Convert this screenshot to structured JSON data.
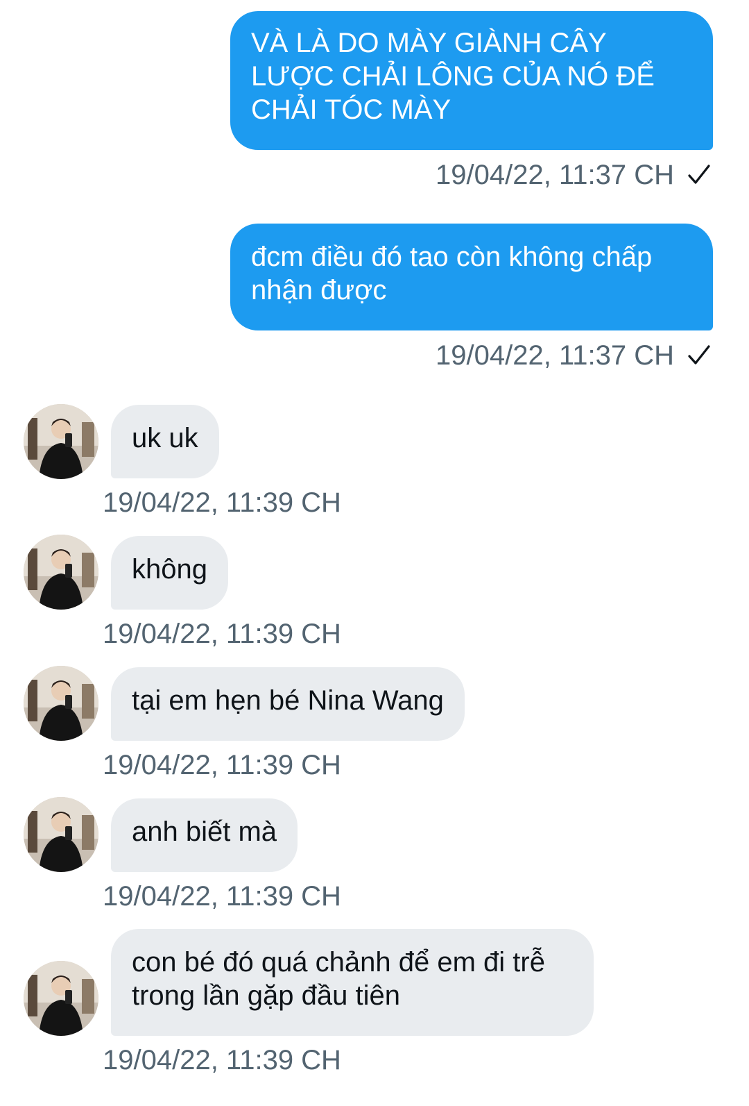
{
  "messages": [
    {
      "direction": "out",
      "text": "VÀ LÀ DO MÀY GIÀNH CÂY LƯỢC CHẢI LÔNG CỦA NÓ ĐỂ CHẢI TÓC MÀY",
      "time": "19/04/22, 11:37 CH",
      "status_icon": "sent-check-icon"
    },
    {
      "direction": "out",
      "text": "đcm điều đó tao còn không chấp nhận được",
      "time": "19/04/22, 11:37 CH",
      "status_icon": "sent-check-icon"
    },
    {
      "direction": "in",
      "text": "uk uk",
      "time": "19/04/22, 11:39 CH",
      "avatar_icon": "avatar-photo"
    },
    {
      "direction": "in",
      "text": "không",
      "time": "19/04/22, 11:39 CH",
      "avatar_icon": "avatar-photo"
    },
    {
      "direction": "in",
      "text": "tại em hẹn bé Nina Wang",
      "time": "19/04/22, 11:39 CH",
      "avatar_icon": "avatar-photo"
    },
    {
      "direction": "in",
      "text": "anh biết mà",
      "time": "19/04/22, 11:39 CH",
      "avatar_icon": "avatar-photo"
    },
    {
      "direction": "in",
      "text": "con bé đó quá chảnh để em đi trễ trong lần gặp đầu tiên",
      "time": "19/04/22, 11:39 CH",
      "avatar_icon": "avatar-photo"
    }
  ],
  "colors": {
    "outgoing_bubble": "#1d9bf0",
    "incoming_bubble": "#e9ecef",
    "timestamp": "#536471"
  }
}
